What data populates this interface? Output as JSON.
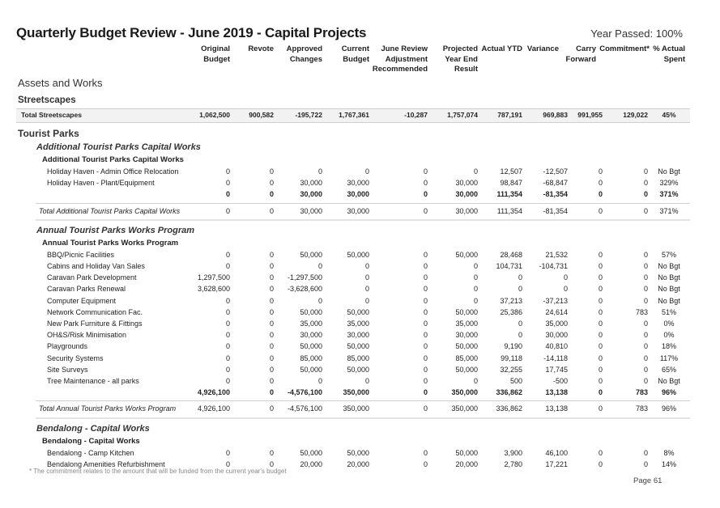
{
  "title": "Quarterly Budget Review - June 2019 - Capital Projects",
  "year_passed": "Year Passed: 100%",
  "columns": [
    {
      "line1": "Original",
      "line2": "Budget",
      "line3": ""
    },
    {
      "line1": "Revote",
      "line2": "",
      "line3": ""
    },
    {
      "line1": "Approved",
      "line2": "Changes",
      "line3": ""
    },
    {
      "line1": "Current",
      "line2": "Budget",
      "line3": ""
    },
    {
      "line1": "June Review",
      "line2": "Adjustment",
      "line3": "Recommended"
    },
    {
      "line1": "Projected",
      "line2": "Year End",
      "line3": "Result"
    },
    {
      "line1": "Actual YTD",
      "line2": "",
      "line3": ""
    },
    {
      "line1": "Variance",
      "line2": "",
      "line3": ""
    },
    {
      "line1": "Carry",
      "line2": "Forward",
      "line3": ""
    },
    {
      "line1": "Commitment*",
      "line2": "",
      "line3": ""
    },
    {
      "line1": "% Actual",
      "line2": "Spent",
      "line3": ""
    }
  ],
  "section": "Assets and Works",
  "streetscapes": {
    "heading": "Streetscapes",
    "total": {
      "label": "Total Streetscapes",
      "values": [
        "1,062,500",
        "900,582",
        "-195,722",
        "1,767,361",
        "-10,287",
        "1,757,074",
        "787,191",
        "969,883",
        "991,955",
        "129,022",
        "45%"
      ]
    }
  },
  "tourist_parks": {
    "heading": "Tourist Parks",
    "groups": [
      {
        "heading": "Additional Tourist Parks Capital Works",
        "subheading": "Additional Tourist Parks Capital Works",
        "rows": [
          {
            "label": "Holiday Haven - Admin Office Relocation",
            "values": [
              "0",
              "0",
              "0",
              "0",
              "0",
              "0",
              "12,507",
              "-12,507",
              "0",
              "0",
              "No Bgt"
            ]
          },
          {
            "label": "Holiday Haven - Plant/Equipment",
            "values": [
              "0",
              "0",
              "30,000",
              "30,000",
              "0",
              "30,000",
              "98,847",
              "-68,847",
              "0",
              "0",
              "329%"
            ]
          }
        ],
        "subtotal": {
          "label": "",
          "values": [
            "0",
            "0",
            "30,000",
            "30,000",
            "0",
            "30,000",
            "111,354",
            "-81,354",
            "0",
            "0",
            "371%"
          ]
        },
        "total": {
          "label": "Total Additional Tourist Parks Capital Works",
          "values": [
            "0",
            "0",
            "30,000",
            "30,000",
            "0",
            "30,000",
            "111,354",
            "-81,354",
            "0",
            "0",
            "371%"
          ]
        }
      },
      {
        "heading": "Annual Tourist Parks Works Program",
        "subheading": "Annual Tourist Parks Works Program",
        "rows": [
          {
            "label": "BBQ/Picnic Facilities",
            "values": [
              "0",
              "0",
              "50,000",
              "50,000",
              "0",
              "50,000",
              "28,468",
              "21,532",
              "0",
              "0",
              "57%"
            ]
          },
          {
            "label": "Cabins and Holiday Van Sales",
            "values": [
              "0",
              "0",
              "0",
              "0",
              "0",
              "0",
              "104,731",
              "-104,731",
              "0",
              "0",
              "No Bgt"
            ]
          },
          {
            "label": "Caravan Park Development",
            "values": [
              "1,297,500",
              "0",
              "-1,297,500",
              "0",
              "0",
              "0",
              "0",
              "0",
              "0",
              "0",
              "No Bgt"
            ]
          },
          {
            "label": "Caravan Parks Renewal",
            "values": [
              "3,628,600",
              "0",
              "-3,628,600",
              "0",
              "0",
              "0",
              "0",
              "0",
              "0",
              "0",
              "No Bgt"
            ]
          },
          {
            "label": "Computer Equipment",
            "values": [
              "0",
              "0",
              "0",
              "0",
              "0",
              "0",
              "37,213",
              "-37,213",
              "0",
              "0",
              "No Bgt"
            ]
          },
          {
            "label": "Network Communication Fac.",
            "values": [
              "0",
              "0",
              "50,000",
              "50,000",
              "0",
              "50,000",
              "25,386",
              "24,614",
              "0",
              "783",
              "51%"
            ]
          },
          {
            "label": "New Park Furniture & Fittings",
            "values": [
              "0",
              "0",
              "35,000",
              "35,000",
              "0",
              "35,000",
              "0",
              "35,000",
              "0",
              "0",
              "0%"
            ]
          },
          {
            "label": "OH&S/Risk Minimisation",
            "values": [
              "0",
              "0",
              "30,000",
              "30,000",
              "0",
              "30,000",
              "0",
              "30,000",
              "0",
              "0",
              "0%"
            ]
          },
          {
            "label": "Playgrounds",
            "values": [
              "0",
              "0",
              "50,000",
              "50,000",
              "0",
              "50,000",
              "9,190",
              "40,810",
              "0",
              "0",
              "18%"
            ]
          },
          {
            "label": "Security Systems",
            "values": [
              "0",
              "0",
              "85,000",
              "85,000",
              "0",
              "85,000",
              "99,118",
              "-14,118",
              "0",
              "0",
              "117%"
            ]
          },
          {
            "label": "Site Surveys",
            "values": [
              "0",
              "0",
              "50,000",
              "50,000",
              "0",
              "50,000",
              "32,255",
              "17,745",
              "0",
              "0",
              "65%"
            ]
          },
          {
            "label": "Tree Maintenance - all parks",
            "values": [
              "0",
              "0",
              "0",
              "0",
              "0",
              "0",
              "500",
              "-500",
              "0",
              "0",
              "No Bgt"
            ]
          }
        ],
        "subtotal": {
          "label": "",
          "values": [
            "4,926,100",
            "0",
            "-4,576,100",
            "350,000",
            "0",
            "350,000",
            "336,862",
            "13,138",
            "0",
            "783",
            "96%"
          ]
        },
        "total": {
          "label": "Total Annual Tourist Parks Works Program",
          "values": [
            "4,926,100",
            "0",
            "-4,576,100",
            "350,000",
            "0",
            "350,000",
            "336,862",
            "13,138",
            "0",
            "783",
            "96%"
          ]
        }
      },
      {
        "heading": "Bendalong - Capital Works",
        "subheading": "Bendalong - Capital Works",
        "rows": [
          {
            "label": "Bendalong - Camp Kitchen",
            "values": [
              "0",
              "0",
              "50,000",
              "50,000",
              "0",
              "50,000",
              "3,900",
              "46,100",
              "0",
              "0",
              "8%"
            ]
          },
          {
            "label": "Bendalong Amenities Refurbishment",
            "values": [
              "0",
              "0",
              "20,000",
              "20,000",
              "0",
              "20,000",
              "2,780",
              "17,221",
              "0",
              "0",
              "14%"
            ]
          }
        ]
      }
    ]
  },
  "footnote": "* The commitment relates to the amount that will be funded from the current year's budget",
  "page": "Page 61"
}
